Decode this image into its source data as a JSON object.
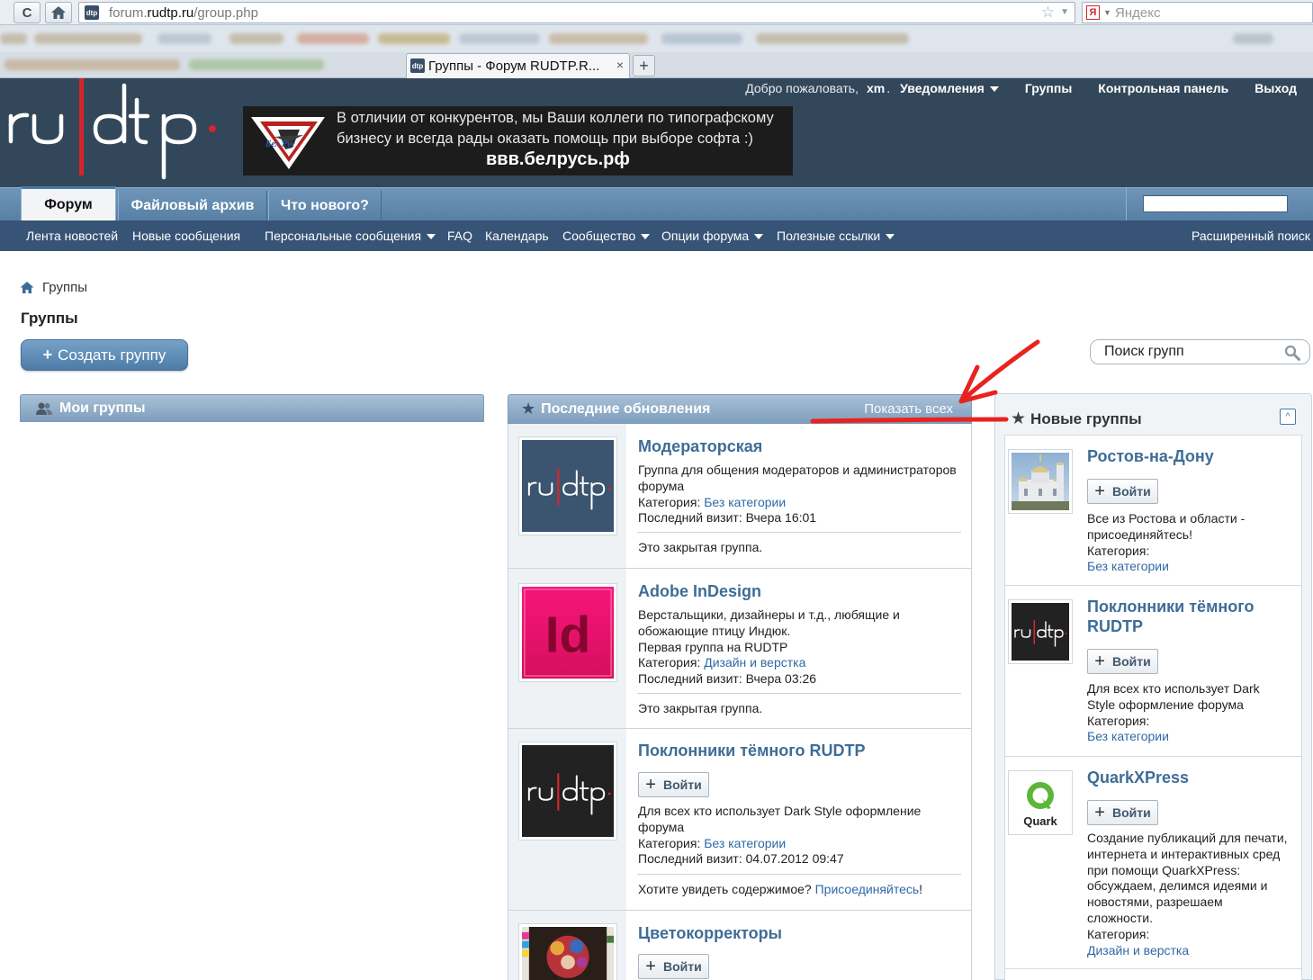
{
  "browser": {
    "url_prefix": "forum.",
    "url_domain": "rudtp.ru",
    "url_path": "/group.php",
    "search_engine": "Яндекс",
    "search_engine_logo": "Я",
    "tab_title": "Группы - Форум RUDTP.R...",
    "tab_close": "×",
    "new_tab": "+",
    "favicon_text": "dtp"
  },
  "header": {
    "logo_text": "ru|dtp",
    "welcome": "Добро пожаловать,",
    "username": "xm",
    "separator": ".",
    "user_menu": [
      "Уведомления",
      "Группы",
      "Контрольная панель",
      "Выход"
    ],
    "banner": {
      "line1": "В отличии от конкурентов, мы Ваши коллеги по типографскому",
      "line2": "бизнесу и всегда рады оказать помощь при выборе софта :)",
      "url": "ввв.белрусь.рф",
      "logo_text": "Бел Рус"
    }
  },
  "nav": {
    "tabs": [
      "Форум",
      "Файловый архив",
      "Что нового?"
    ],
    "active_tab": "Форум",
    "search_placeholder": "",
    "subnav": [
      "Лента новостей",
      "Новые сообщения",
      "Персональные сообщения",
      "FAQ",
      "Календарь",
      "Сообщество",
      "Опции форума",
      "Полезные ссылки"
    ],
    "advanced_search": "Расширенный поиск"
  },
  "page": {
    "breadcrumb": "Группы",
    "title": "Группы",
    "create_button": "Создать группу",
    "create_plus": "+",
    "group_search": "Поиск групп"
  },
  "my_groups": {
    "title": "Мои группы"
  },
  "latest": {
    "title": "Последние обновления",
    "show_all": "Показать всех",
    "groups": [
      {
        "name": "Модераторская",
        "desc1": "Группа для общения модераторов и администраторов",
        "desc2": "форума",
        "category_label": "Категория:",
        "category": "Без категории",
        "last_visit": "Последний визит: Вчера 16:01",
        "footer": "Это закрытая группа.",
        "thumb": "rudtp-logo-blue"
      },
      {
        "name": "Adobe InDesign",
        "desc1": "Верстальщики, дизайнеры и т.д., любящие и",
        "desc2": "обожающие птицу Индюк.",
        "desc3": "Первая группа на RUDTP",
        "category_label": "Категория:",
        "category": "Дизайн и верстка",
        "last_visit": "Последний визит: Вчера 03:26",
        "footer": "Это закрытая группа.",
        "thumb": "indesign-logo",
        "thumb_text": "Id"
      },
      {
        "name": "Поклонники тёмного RUDTP",
        "join": "Войти",
        "desc1": "Для всех кто использует Dark Style оформление",
        "desc2": "форума",
        "category_label": "Категория:",
        "category": "Без категории",
        "last_visit": "Последний визит: 04.07.2012 09:47",
        "footer_text": "Хотите увидеть содержимое?",
        "footer_link": "Присоединяйтесь",
        "footer_end": "!",
        "thumb": "rudtp-logo-dark"
      },
      {
        "name": "Цветокорректоры",
        "join": "Войти",
        "thumb": "photo-colorful"
      }
    ]
  },
  "new_groups": {
    "title": "Новые группы",
    "collapse_icon": "^",
    "groups": [
      {
        "name_line1": "Ростов-на-Дону",
        "join": "Войти",
        "desc1": "Все из Ростова и области -",
        "desc2": "присоединяйтесь!",
        "category_label": "Категория:",
        "category": "Без категории",
        "thumb": "church-photo"
      },
      {
        "name_line1": "Поклонники тёмного",
        "name_line2": "RUDTP",
        "join": "Войти",
        "desc1": "Для всех кто использует Dark",
        "desc2": "Style оформление форума",
        "category_label": "Категория:",
        "category": "Без категории",
        "thumb": "rudtp-logo-dark"
      },
      {
        "name_line1": "QuarkXPress",
        "join": "Войти",
        "desc1": "Создание публикаций для печати,",
        "desc2": "интернета и интерактивных сред",
        "desc3": "при помощи QuarkXPress:",
        "desc4": "обсуждаем, делимся идеями и",
        "desc5": "новостями, разрешаем",
        "desc6": "сложности.",
        "category_label": "Категория:",
        "category": "Дизайн и верстка",
        "thumb": "quark-logo",
        "thumb_text": "Quark"
      }
    ]
  },
  "colors": {
    "header_bg": "#33475a",
    "nav_tab_bg": "#5f87ad",
    "subnav_bg": "#375476",
    "link": "#2f69a5",
    "group_name": "#3e6d97",
    "logo_red": "#d5252c",
    "annotation_red": "#e8231f"
  }
}
